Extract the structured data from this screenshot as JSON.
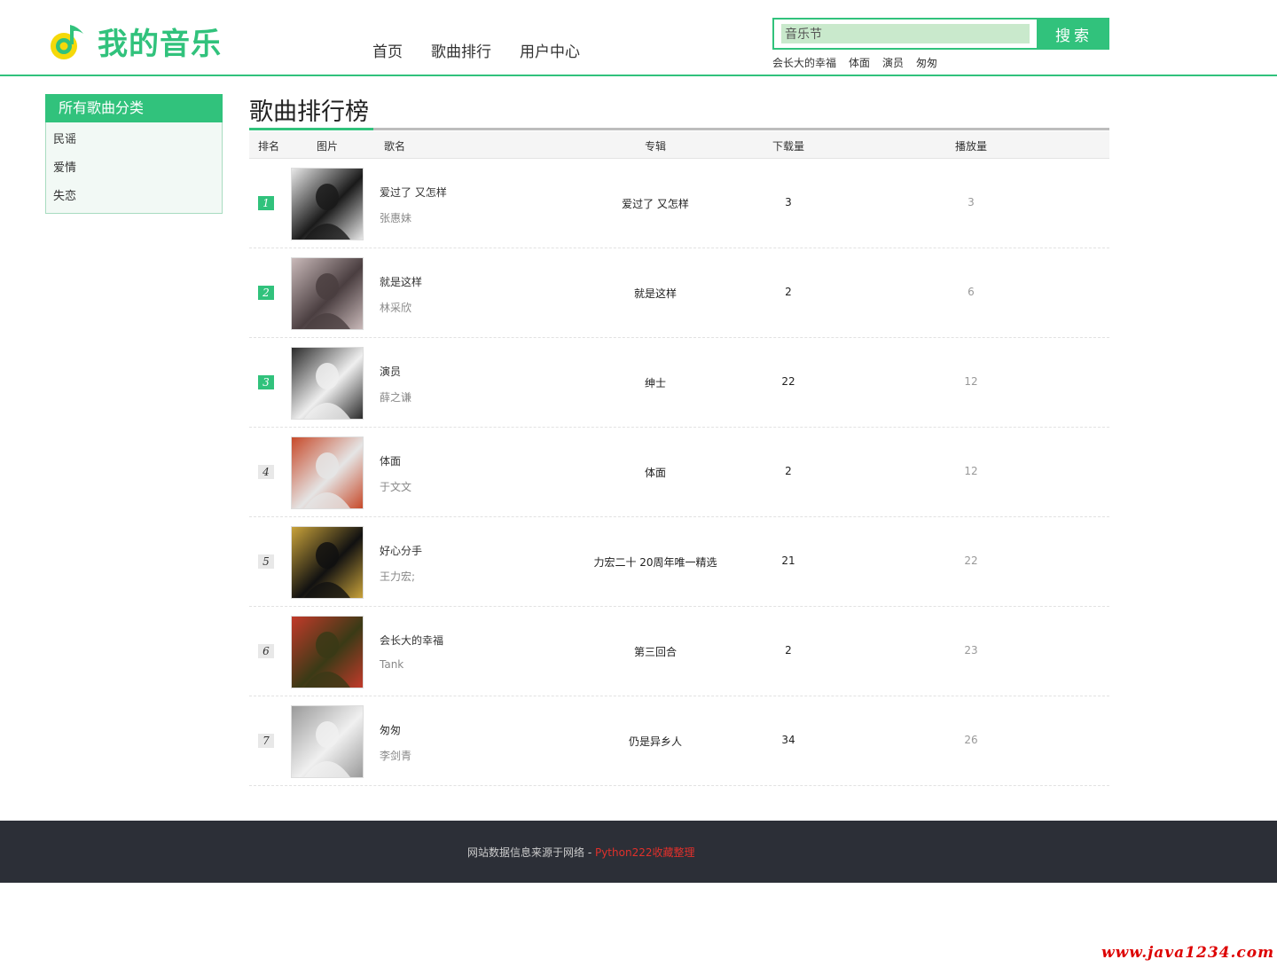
{
  "logo": {
    "text": "我的音乐"
  },
  "nav": [
    "首页",
    "歌曲排行",
    "用户中心"
  ],
  "search": {
    "value": "音乐节",
    "button": "搜索"
  },
  "hot_keywords": [
    "会长大的幸福",
    "体面",
    "演员",
    "匆匆"
  ],
  "sidebar": {
    "title": "所有歌曲分类",
    "items": [
      "民谣",
      "爱情",
      "失恋"
    ]
  },
  "main": {
    "title": "歌曲排行榜",
    "columns": {
      "rank": "排名",
      "image": "图片",
      "song": "歌名",
      "album": "专辑",
      "downloads": "下载量",
      "plays": "播放量"
    },
    "rows": [
      {
        "rank": "1",
        "song": "爱过了 又怎样",
        "singer": "张惠妹",
        "album": "爱过了 又怎样",
        "downloads": "3",
        "plays": "3",
        "colors": [
          "#1a1a1a",
          "#e8e8e8"
        ]
      },
      {
        "rank": "2",
        "song": "就是这样",
        "singer": "林采欣",
        "album": "就是这样",
        "downloads": "2",
        "plays": "6",
        "colors": [
          "#4a3e40",
          "#c9b9b9"
        ]
      },
      {
        "rank": "3",
        "song": "演员",
        "singer": "薛之谦",
        "album": "绅士",
        "downloads": "22",
        "plays": "12",
        "colors": [
          "#efefef",
          "#2a2a2a"
        ]
      },
      {
        "rank": "4",
        "song": "体面",
        "singer": "于文文",
        "album": "体面",
        "downloads": "2",
        "plays": "12",
        "colors": [
          "#e5e5e5",
          "#c74a2a"
        ]
      },
      {
        "rank": "5",
        "song": "好心分手",
        "singer": "王力宏;",
        "album": "力宏二十 20周年唯一精选",
        "downloads": "21",
        "plays": "22",
        "colors": [
          "#111",
          "#c9a23a"
        ]
      },
      {
        "rank": "6",
        "song": "会长大的幸福",
        "singer": "Tank",
        "album": "第三回合",
        "downloads": "2",
        "plays": "23",
        "colors": [
          "#3a3a16",
          "#c23a2a"
        ]
      },
      {
        "rank": "7",
        "song": "匆匆",
        "singer": "李剑青",
        "album": "仍是异乡人",
        "downloads": "34",
        "plays": "26",
        "colors": [
          "#f0f0f0",
          "#9a9a9a"
        ]
      }
    ]
  },
  "footer": {
    "text": "网站数据信息来源于网络 - ",
    "link": "Python222收藏整理"
  },
  "watermark": "www.java1234.com",
  "colors": {
    "accent": "#31c27c",
    "footer_bg": "#2c2f37",
    "link": "#e0302b"
  }
}
